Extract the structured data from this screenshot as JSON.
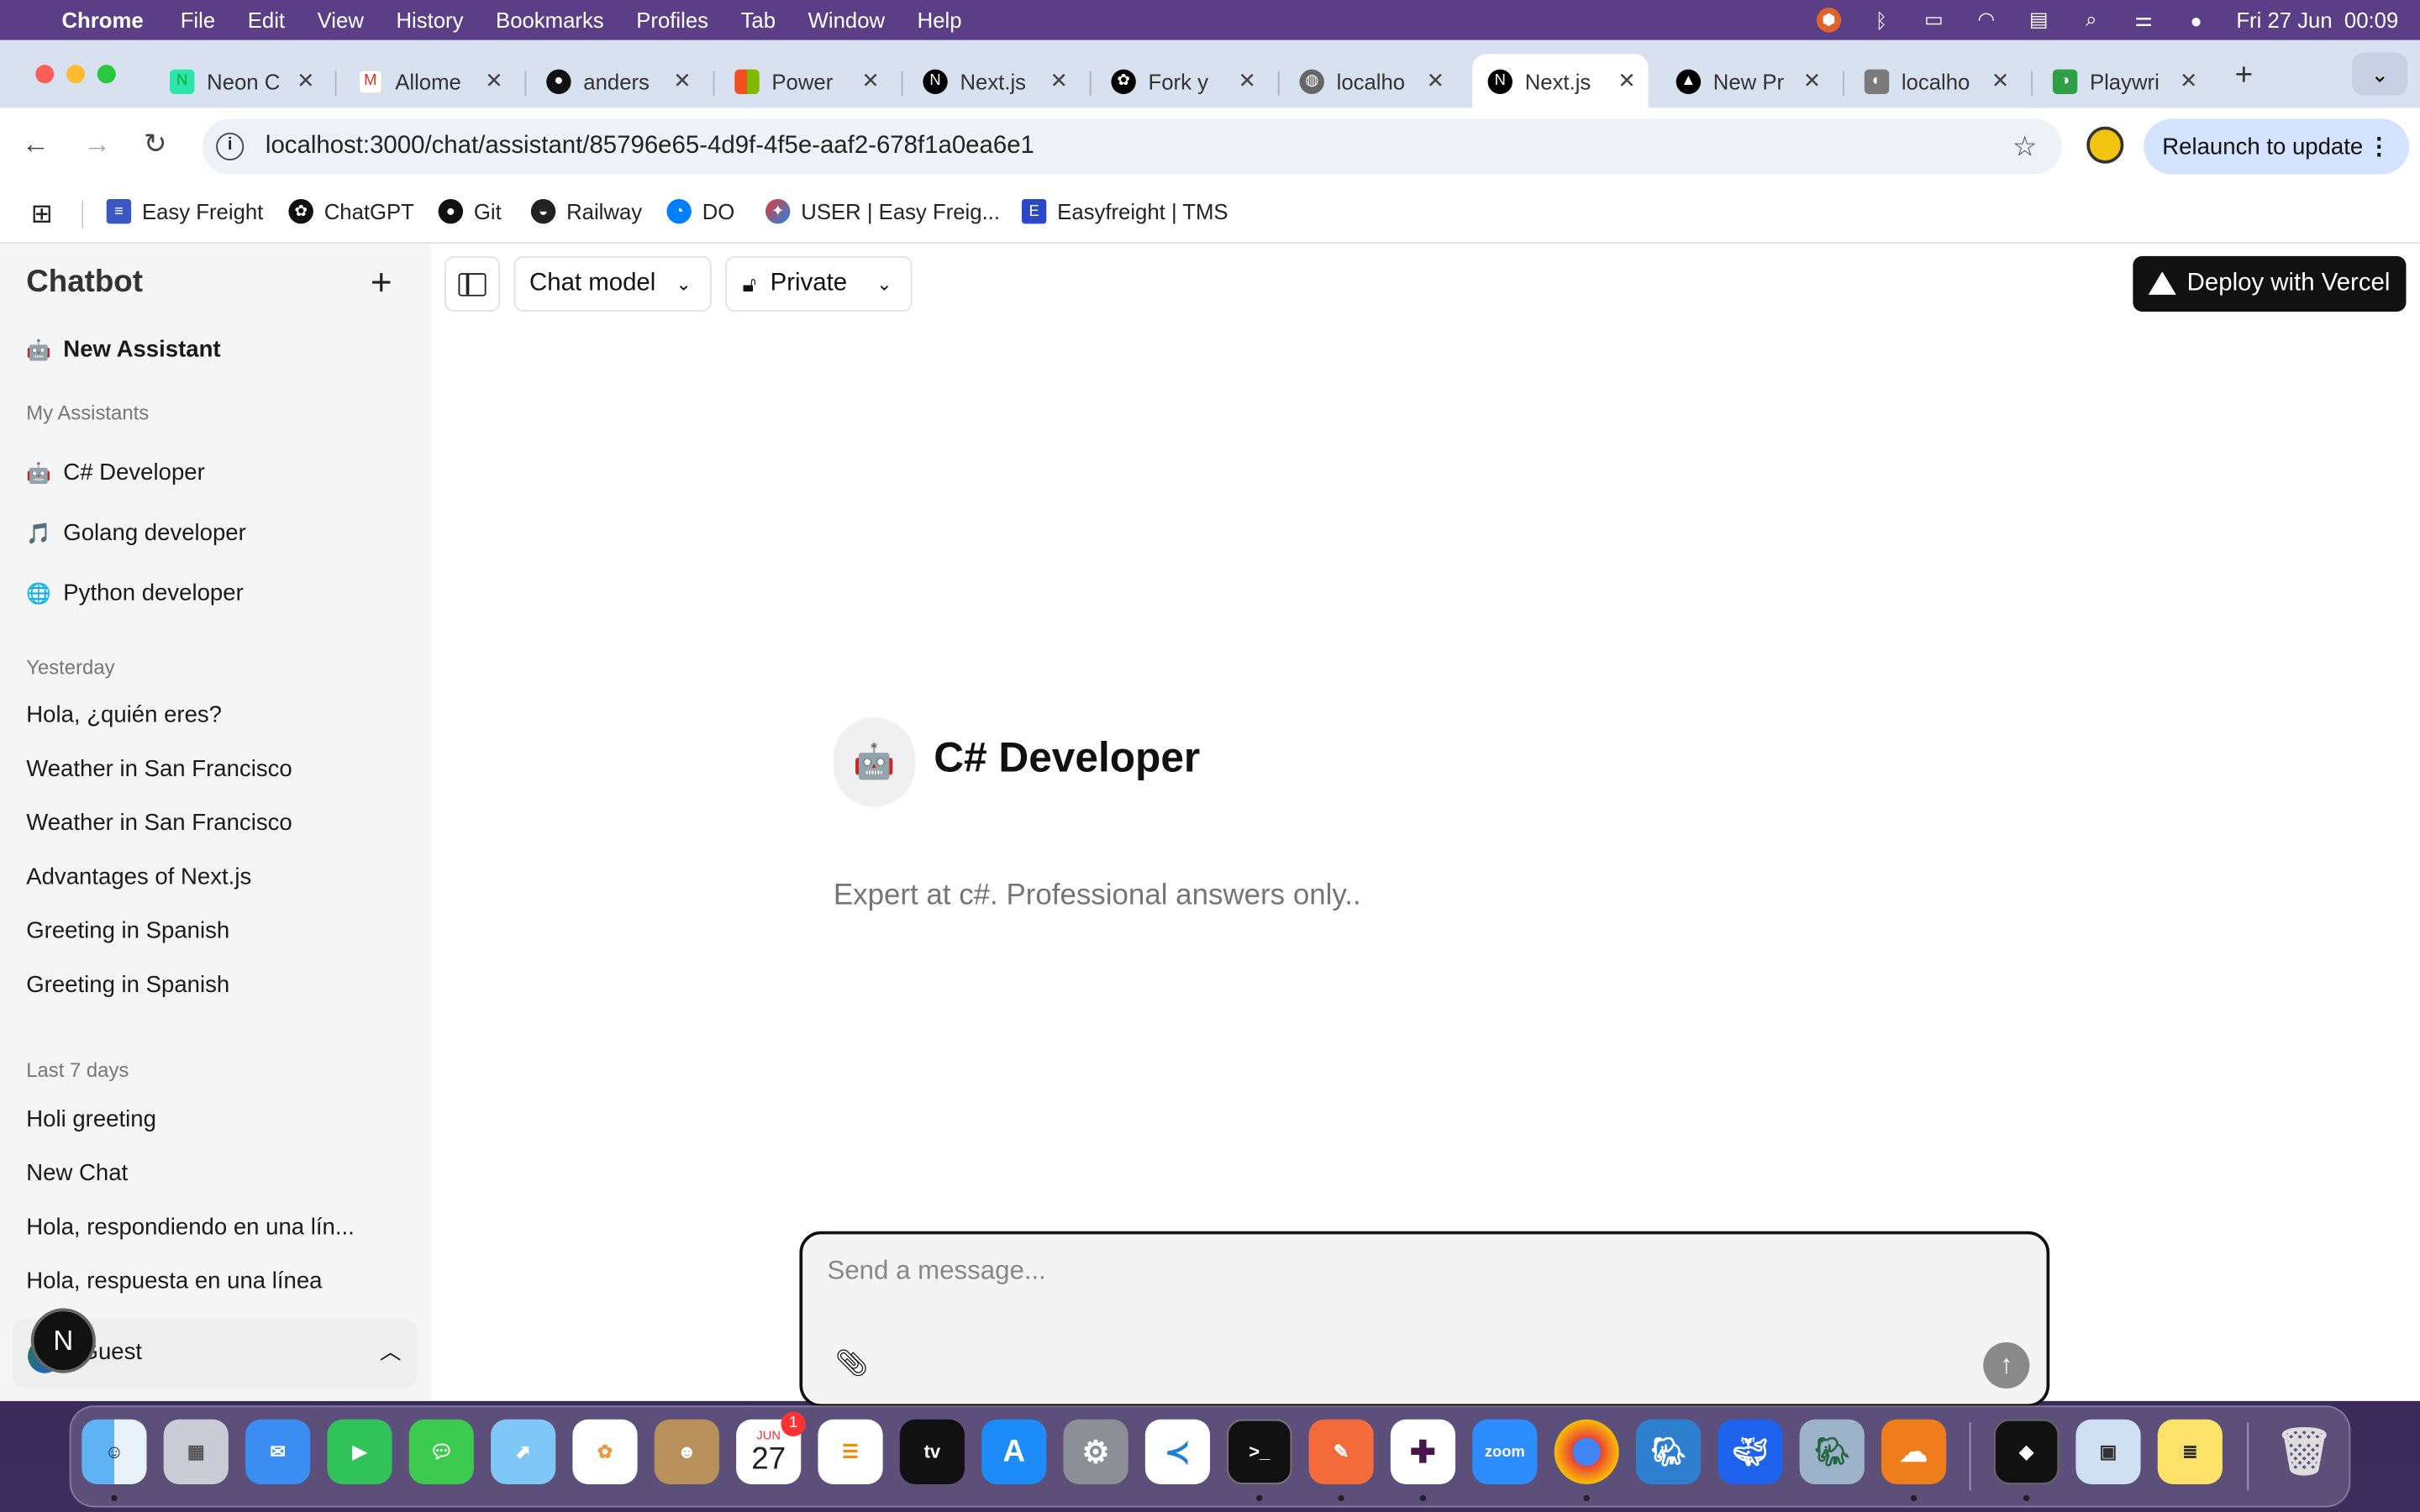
{
  "menubar": {
    "app": "Chrome",
    "items": [
      "File",
      "Edit",
      "View",
      "History",
      "Bookmarks",
      "Profiles",
      "Tab",
      "Window",
      "Help"
    ],
    "datetime": "Fri 27 Jun  00:09"
  },
  "tabs": [
    {
      "title": "Neon C",
      "icon": "neon-icon"
    },
    {
      "title": "Allome",
      "icon": "gmail-icon"
    },
    {
      "title": "anders",
      "icon": "github-icon"
    },
    {
      "title": "Power",
      "icon": "microsoft-icon"
    },
    {
      "title": "Next.js",
      "icon": "nextjs-icon"
    },
    {
      "title": "Fork y",
      "icon": "openai-icon"
    },
    {
      "title": "localho",
      "icon": "globe-icon"
    },
    {
      "title": "Next.js",
      "icon": "nextjs-icon",
      "active": true
    },
    {
      "title": "New Pr",
      "icon": "vercel-icon"
    },
    {
      "title": "localho",
      "icon": "playwright-icon"
    },
    {
      "title": "Playwri",
      "icon": "playwright-icon"
    }
  ],
  "toolbar": {
    "url": "localhost:3000/chat/assistant/85796e65-4d9f-4f5e-aaf2-678f1a0ea6e1",
    "relaunch_label": "Relaunch to update"
  },
  "bookmarks": [
    "Easy Freight",
    "ChatGPT",
    "Git",
    "Railway",
    "DO",
    "USER | Easy Freig...",
    "Easyfreight | TMS"
  ],
  "sidebar": {
    "title": "Chatbot",
    "new_assistant": "New Assistant",
    "my_assistants_label": "My Assistants",
    "assistants": [
      {
        "emoji": "🤖",
        "name": "C# Developer"
      },
      {
        "emoji": "🎵",
        "name": "Golang developer"
      },
      {
        "emoji": "🌐",
        "name": "Python developer"
      }
    ],
    "groups": [
      {
        "label": "Yesterday",
        "items": [
          "Hola, ¿quién eres?",
          "Weather in San Francisco",
          "Weather in San Francisco",
          "Advantages of Next.js",
          "Greeting in Spanish",
          "Greeting in Spanish"
        ]
      },
      {
        "label": "Last 7 days",
        "items": [
          "Holi greeting",
          "New Chat",
          "Hola, respondiendo en una lín...",
          "Hola, respuesta en una línea"
        ]
      }
    ],
    "user_label": "Guest",
    "avatar_letter": "N"
  },
  "header": {
    "chat_model_label": "Chat model",
    "visibility_label": "Private",
    "deploy_label": "Deploy with Vercel"
  },
  "hero": {
    "emoji": "🤖",
    "title": "C# Developer",
    "description": "Expert at c#. Professional answers only.."
  },
  "composer": {
    "placeholder": "Send a message...",
    "value": ""
  },
  "dock": {
    "calendar_month": "JUN",
    "calendar_day": "27",
    "calendar_badge": "1",
    "zoom_label": "zoom"
  }
}
